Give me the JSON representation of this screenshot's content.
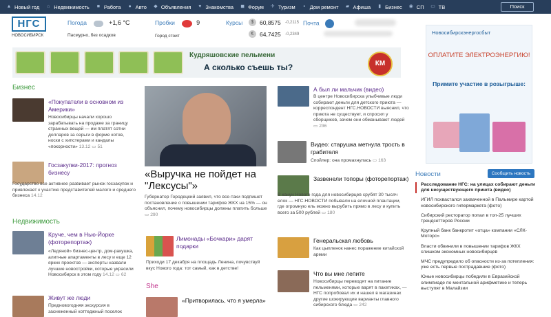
{
  "nav": {
    "items": [
      {
        "label": "Новый год",
        "icon": "christmas-tree-icon"
      },
      {
        "label": "Недвижимость",
        "icon": "house-icon"
      },
      {
        "label": "Работа",
        "icon": "briefcase-icon"
      },
      {
        "label": "Авто",
        "icon": "car-icon"
      },
      {
        "label": "Объявления",
        "icon": "megaphone-icon"
      },
      {
        "label": "Знакомства",
        "icon": "heart-icon"
      },
      {
        "label": "Форум",
        "icon": "chat-icon"
      },
      {
        "label": "Туризм",
        "icon": "plane-icon"
      },
      {
        "label": "Дом ремонт",
        "icon": "hammer-icon"
      },
      {
        "label": "Афиша",
        "icon": "ticket-icon"
      },
      {
        "label": "Бизнес",
        "icon": "chart-icon"
      },
      {
        "label": "СП",
        "icon": "group-icon"
      },
      {
        "label": "ТВ",
        "icon": "tv-icon"
      }
    ],
    "search_label": "Поиск"
  },
  "logo": {
    "mark": "НГС",
    "city": "НОВОСИБИРСК"
  },
  "weather": {
    "label": "Погода",
    "temp": "+1,6 °C",
    "desc": "Пасмурно, без осадков"
  },
  "traffic": {
    "label": "Пробки",
    "score": "9",
    "desc": "Город стоит"
  },
  "rates": {
    "label": "Курсы",
    "usd": {
      "value": "60,8575",
      "change": "-0,2115"
    },
    "eur": {
      "value": "64,7425",
      "change": "-0,2349"
    }
  },
  "mail": {
    "label": "Почта"
  },
  "ad_banner": {
    "line1": "Кудряшовские пельмени",
    "line2": "А сколько съешь ты?",
    "badge": "КМ"
  },
  "side_ad": {
    "brand": "Новосибирскэнергосбыт",
    "line1": "ОПЛАТИТЕ ЭЛЕКТРОЭНЕРГИЮ!",
    "line2": "Примите участие в розыгрыше:"
  },
  "business": {
    "title": "Бизнес",
    "articles": [
      {
        "title": "«Покупатели в основном из Америки»",
        "body": "Новосибирцы начали хорошо зарабатывать на продаже за границу странных вещей — им платят сотни долларов за серьги в форме котов, носки с хипстерами и кандалы «покорности»",
        "date": "13.12",
        "comments": "51"
      },
      {
        "title": "Госзакупки-2017: прогноз бизнесу",
        "body": "Государство все активнее развивает рынок госзакупок и привлекает к участию представителей малого и среднего бизнеса",
        "date": "14.12"
      }
    ]
  },
  "realty": {
    "title": "Недвижимость",
    "articles": [
      {
        "title": "Круче, чем в Нью-Йорке (фоторепортаж)",
        "body": "«Ледяной» бизнес-центр, дом-ракушка, алитные апартаменты в лесу и еще 12 ярких проектов — эксперты назвали лучшие новостройки, которые украсили Новосибирск в этом году",
        "date": "14.12",
        "comments": "62"
      },
      {
        "title": "Живут же люди",
        "body": "Предновогодняя экскурсия в заснеженный коттеджный поселок"
      }
    ]
  },
  "lead": {
    "title": "«Выручка не пойдет на \"Лексусы\"»",
    "body": "Губернатор Городецкий заявил, что все-таки подпишет постановление о повышении тарифов ЖКХ на 15% — он объяснил, почему новосибирцы должны платить больше",
    "comments": "290"
  },
  "lemonade": {
    "title": "Лимонады «Бочкари» дарят подарки",
    "body": "Приходи 17 декабря на площадь Ленина, почувствуй вкус Нового года: тот самый, как в детстве!"
  },
  "she": {
    "title": "She",
    "article_title": "«Притворилась, что я умерла»"
  },
  "mid_articles": [
    {
      "title": "А был ли мальчик (видео)",
      "body": "В центре Новосибирска улыбчивые люди собирают деньги для детского приюта — корреспондент НГС.НОВОСТИ выяснил, что приюта не существует, и спросил у сборщиков, зачем они обманывают людей",
      "comments": "236"
    },
    {
      "title": "Видео: старушка метнула трость в грабителя",
      "body": "Спойлер: она промахнулась",
      "comments": "163"
    },
    {
      "title": "Зазвенели топоры (фоторепортаж)",
      "body": "В канун Нового года для новосибирцев срубят 30 тысяч елок — НГС.НОВОСТИ побывали на елочной плантации, где огромную ель можно вырубить прямо в лесу и купить всего за 500 рублей",
      "comments": "180"
    },
    {
      "title": "Генеральская любовь",
      "body": "Как цыпленок нанес поражение китайской армии"
    },
    {
      "title": "Что вы мне лепите",
      "body": "Новосибирцы переводят на питание пельменями, которые варят в пакетиках, — НГС попробовал их и нашел в магазинах другие шокирующие варианты главного сибирского блюда",
      "comments": "242"
    }
  ],
  "news": {
    "title": "Новости",
    "report_button": "Сообщить новость",
    "items": [
      {
        "text": "Расследование НГС: на улицах собирают деньги для несуществующего приюта (видео)",
        "highlight": true
      },
      {
        "text": "ИГИЛ похвастался захваченной в Пальмире картой новосибирского гипермаркета (фото)"
      },
      {
        "text": "Сибирский ресторатор попал в топ-25 лучших трендсеттеров России"
      },
      {
        "text": "Крупный банк банкротит «отца» компании «СЛК-Моторс»"
      },
      {
        "text": "Власти обвинили в повышении тарифов ЖКХ слишком экономных новосибирцев"
      },
      {
        "text": "МЧС предупредило об опасности из-за потепления: уже есть первые пострадавшие (фото)"
      },
      {
        "text": "Юные новосибирцы победили в Евразийской олимпиаде по ментальной арифметике и теперь выступят в Малайзии"
      }
    ]
  }
}
